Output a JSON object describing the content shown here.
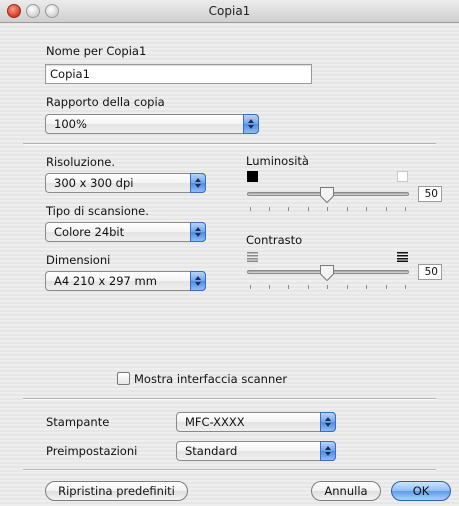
{
  "window": {
    "title": "Copia1"
  },
  "nome": {
    "label": "Nome per Copia1",
    "value": "Copia1"
  },
  "rapporto": {
    "label": "Rapporto della copia",
    "value": "100%"
  },
  "risoluzione": {
    "label": "Risoluzione.",
    "value": "300 x 300 dpi"
  },
  "tipo": {
    "label": "Tipo di scansione.",
    "value": "Colore 24bit"
  },
  "dimensioni": {
    "label": "Dimensioni",
    "value": "A4  210 x 297 mm"
  },
  "luminosita": {
    "label": "Luminosità",
    "value": "50"
  },
  "contrasto": {
    "label": "Contrasto",
    "value": "50"
  },
  "scanner_checkbox": {
    "label": "Mostra interfaccia scanner",
    "checked": false
  },
  "stampante": {
    "label": "Stampante",
    "value": "MFC-XXXX"
  },
  "preimpostazioni": {
    "label": "Preimpostazioni",
    "value": "Standard"
  },
  "buttons": {
    "reset": "Ripristina predefiniti",
    "cancel": "Annulla",
    "ok": "OK"
  },
  "icons": {
    "brightness_low": "black-square-icon",
    "brightness_high": "white-square-icon",
    "contrast_low": "low-contrast-lines-icon",
    "contrast_high": "high-contrast-lines-icon",
    "popup_arrows": "up-down-arrows-icon"
  },
  "colors": {
    "accent": "#5d9be8",
    "close_button": "#d23a24"
  }
}
